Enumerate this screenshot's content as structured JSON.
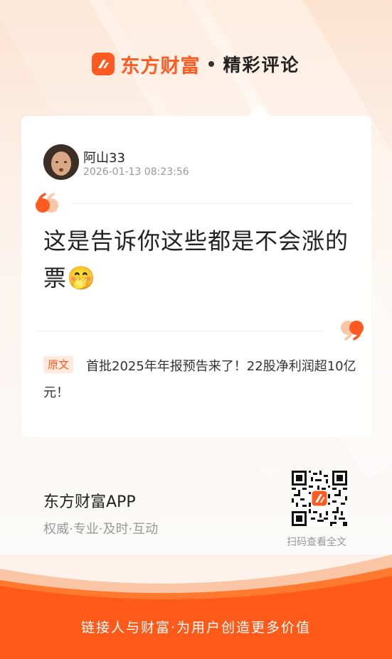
{
  "header": {
    "brand": "东方财富",
    "separator": "•",
    "tagline": "精彩评论",
    "logo_icon": "east-money-logo-icon"
  },
  "comment_card": {
    "username": "阿山33",
    "timestamp": "2026-01-13 08:23:56",
    "content": "这是告诉你这些都是不会涨的票",
    "emoji": "🤭",
    "source_badge": "原文",
    "source_title": "首批2025年年报预告来了！22股净利润超10亿元！"
  },
  "footer": {
    "app_name": "东方财富APP",
    "app_slogan": "权威·专业·及时·互动",
    "qr_label": "扫码查看全文",
    "bottom_slogan": "链接人与财富·为用户创造更多价值"
  },
  "colors": {
    "brand_orange": "#ff5a1f",
    "badge_bg": "#fde9dd"
  }
}
